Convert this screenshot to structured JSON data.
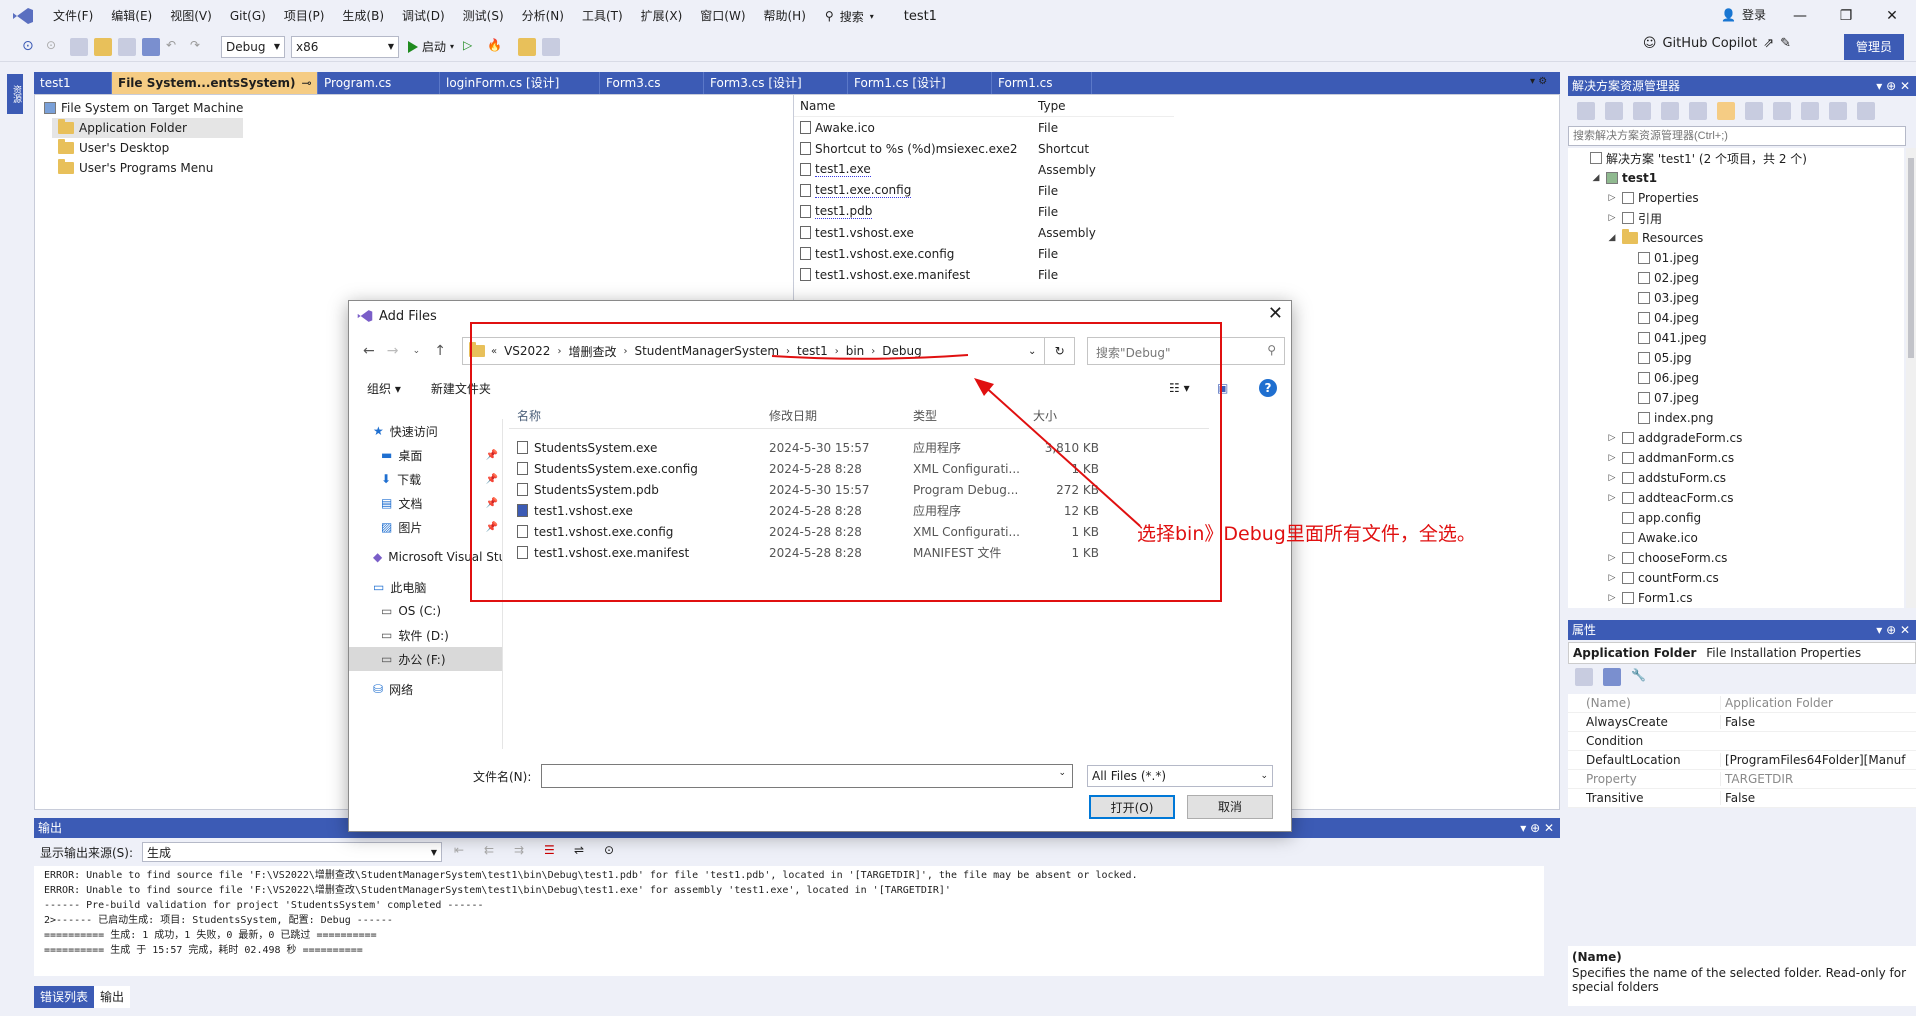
{
  "menubar": {
    "items": [
      "文件(F)",
      "编辑(E)",
      "视图(V)",
      "Git(G)",
      "项目(P)",
      "生成(B)",
      "调试(D)",
      "测试(S)",
      "分析(N)",
      "工具(T)",
      "扩展(X)",
      "窗口(W)",
      "帮助(H)"
    ],
    "search_label": "搜索",
    "solution_name": "test1",
    "login_label": "登录"
  },
  "toolbar": {
    "config": "Debug",
    "platform": "x86",
    "start_label": "启动",
    "copilot_label": "GitHub Copilot",
    "admin_label": "管理员"
  },
  "tabs": [
    "test1",
    "File System...entsSystem)",
    "Program.cs",
    "loginForm.cs [设计]",
    "Form3.cs",
    "Form3.cs [设计]",
    "Form1.cs [设计]",
    "Form1.cs"
  ],
  "fs_tree": {
    "root": "File System on Target Machine",
    "folders": [
      "Application Folder",
      "User's Desktop",
      "User's Programs Menu"
    ]
  },
  "fs_table": {
    "headers": [
      "Name",
      "Type"
    ],
    "rows": [
      {
        "name": "Awake.ico",
        "type": "File"
      },
      {
        "name": "Shortcut to %s (%d)msiexec.exe2",
        "type": "Shortcut"
      },
      {
        "name": "test1.exe",
        "type": "Assembly"
      },
      {
        "name": "test1.exe.config",
        "type": "File"
      },
      {
        "name": "test1.pdb",
        "type": "File"
      },
      {
        "name": "test1.vshost.exe",
        "type": "Assembly"
      },
      {
        "name": "test1.vshost.exe.config",
        "type": "File"
      },
      {
        "name": "test1.vshost.exe.manifest",
        "type": "File"
      }
    ]
  },
  "dialog": {
    "title": "Add Files",
    "breadcrumb": [
      "VS2022",
      "增删查改",
      "StudentManagerSystem",
      "test1",
      "bin",
      "Debug"
    ],
    "search_placeholder": "搜索\"Debug\"",
    "organize": "组织 ▾",
    "new_folder": "新建文件夹",
    "nav": {
      "quick_access": "快速访问",
      "items": [
        "桌面",
        "下载",
        "文档",
        "图片"
      ],
      "vs": "Microsoft Visual Studio",
      "this_pc": "此电脑",
      "drives": [
        "OS (C:)",
        "软件 (D:)",
        "办公 (F:)"
      ],
      "network": "网络"
    },
    "columns": [
      "名称",
      "修改日期",
      "类型",
      "大小"
    ],
    "files": [
      {
        "name": "StudentsSystem.exe",
        "date": "2024-5-30 15:57",
        "type": "应用程序",
        "size": "3,810 KB"
      },
      {
        "name": "StudentsSystem.exe.config",
        "date": "2024-5-28 8:28",
        "type": "XML Configurati...",
        "size": "1 KB"
      },
      {
        "name": "StudentsSystem.pdb",
        "date": "2024-5-30 15:57",
        "type": "Program Debug...",
        "size": "272 KB"
      },
      {
        "name": "test1.vshost.exe",
        "date": "2024-5-28 8:28",
        "type": "应用程序",
        "size": "12 KB"
      },
      {
        "name": "test1.vshost.exe.config",
        "date": "2024-5-28 8:28",
        "type": "XML Configurati...",
        "size": "1 KB"
      },
      {
        "name": "test1.vshost.exe.manifest",
        "date": "2024-5-28 8:28",
        "type": "MANIFEST 文件",
        "size": "1 KB"
      }
    ],
    "filename_label": "文件名(N):",
    "filter": "All Files (*.*)",
    "open": "打开(O)",
    "cancel": "取消"
  },
  "annotation": "选择bin》Debug里面所有文件，全选。",
  "solution_explorer": {
    "title": "解决方案资源管理器",
    "search_placeholder": "搜索解决方案资源管理器(Ctrl+;)",
    "items": [
      {
        "label": "解决方案 'test1' (2 个项目，共 2 个)",
        "indent": 0,
        "arrow": ""
      },
      {
        "label": "test1",
        "indent": 1,
        "arrow": "◢"
      },
      {
        "label": "Properties",
        "indent": 2,
        "arrow": "▷"
      },
      {
        "label": "引用",
        "indent": 2,
        "arrow": "▷"
      },
      {
        "label": "Resources",
        "indent": 2,
        "arrow": "◢"
      },
      {
        "label": "01.jpeg",
        "indent": 3,
        "arrow": ""
      },
      {
        "label": "02.jpeg",
        "indent": 3,
        "arrow": ""
      },
      {
        "label": "03.jpeg",
        "indent": 3,
        "arrow": ""
      },
      {
        "label": "04.jpeg",
        "indent": 3,
        "arrow": ""
      },
      {
        "label": "041.jpeg",
        "indent": 3,
        "arrow": ""
      },
      {
        "label": "05.jpg",
        "indent": 3,
        "arrow": ""
      },
      {
        "label": "06.jpeg",
        "indent": 3,
        "arrow": ""
      },
      {
        "label": "07.jpeg",
        "indent": 3,
        "arrow": ""
      },
      {
        "label": "index.png",
        "indent": 3,
        "arrow": ""
      },
      {
        "label": "addgradeForm.cs",
        "indent": 2,
        "arrow": "▷"
      },
      {
        "label": "addmanForm.cs",
        "indent": 2,
        "arrow": "▷"
      },
      {
        "label": "addstuForm.cs",
        "indent": 2,
        "arrow": "▷"
      },
      {
        "label": "addteacForm.cs",
        "indent": 2,
        "arrow": "▷"
      },
      {
        "label": "app.config",
        "indent": 2,
        "arrow": ""
      },
      {
        "label": "Awake.ico",
        "indent": 2,
        "arrow": ""
      },
      {
        "label": "chooseForm.cs",
        "indent": 2,
        "arrow": "▷"
      },
      {
        "label": "countForm.cs",
        "indent": 2,
        "arrow": "▷"
      },
      {
        "label": "Form1.cs",
        "indent": 2,
        "arrow": "▷"
      }
    ]
  },
  "properties": {
    "title": "属性",
    "object": "Application Folder",
    "object_type": "File Installation Properties",
    "rows": [
      {
        "k": "(Name)",
        "v": "Application Folder",
        "gray": true
      },
      {
        "k": "AlwaysCreate",
        "v": "False",
        "gray": false
      },
      {
        "k": "Condition",
        "v": "",
        "gray": false
      },
      {
        "k": "DefaultLocation",
        "v": "[ProgramFiles64Folder][Manuf",
        "gray": false
      },
      {
        "k": "Property",
        "v": "TARGETDIR",
        "gray": true
      },
      {
        "k": "Transitive",
        "v": "False",
        "gray": false
      }
    ],
    "desc_title": "(Name)",
    "desc_text": "Specifies the name of the selected folder. Read-only for special folders"
  },
  "output": {
    "title": "输出",
    "source_label": "显示输出来源(S):",
    "source_value": "生成",
    "lines": [
      "ERROR: Unable to find source file 'F:\\VS2022\\增删查改\\StudentManagerSystem\\test1\\bin\\Debug\\test1.pdb' for file 'test1.pdb', located in '[TARGETDIR]', the file may be absent or locked.",
      "ERROR: Unable to find source file 'F:\\VS2022\\增删查改\\StudentManagerSystem\\test1\\bin\\Debug\\test1.exe' for assembly 'test1.exe', located in '[TARGETDIR]'",
      "------ Pre-build validation for project 'StudentsSystem' completed ------",
      "2>------ 已启动生成: 项目: StudentsSystem, 配置: Debug ------",
      "========== 生成: 1 成功，1 失败，0 最新，0 已跳过 ==========",
      "========== 生成 于 15:57 完成，耗时 02.498 秒 =========="
    ],
    "bottom_tabs": [
      "错误列表",
      "输出"
    ]
  },
  "colors": {
    "accent": "#3c5bb5",
    "active_tab": "#f5cc84",
    "annotation": "#e01010"
  }
}
